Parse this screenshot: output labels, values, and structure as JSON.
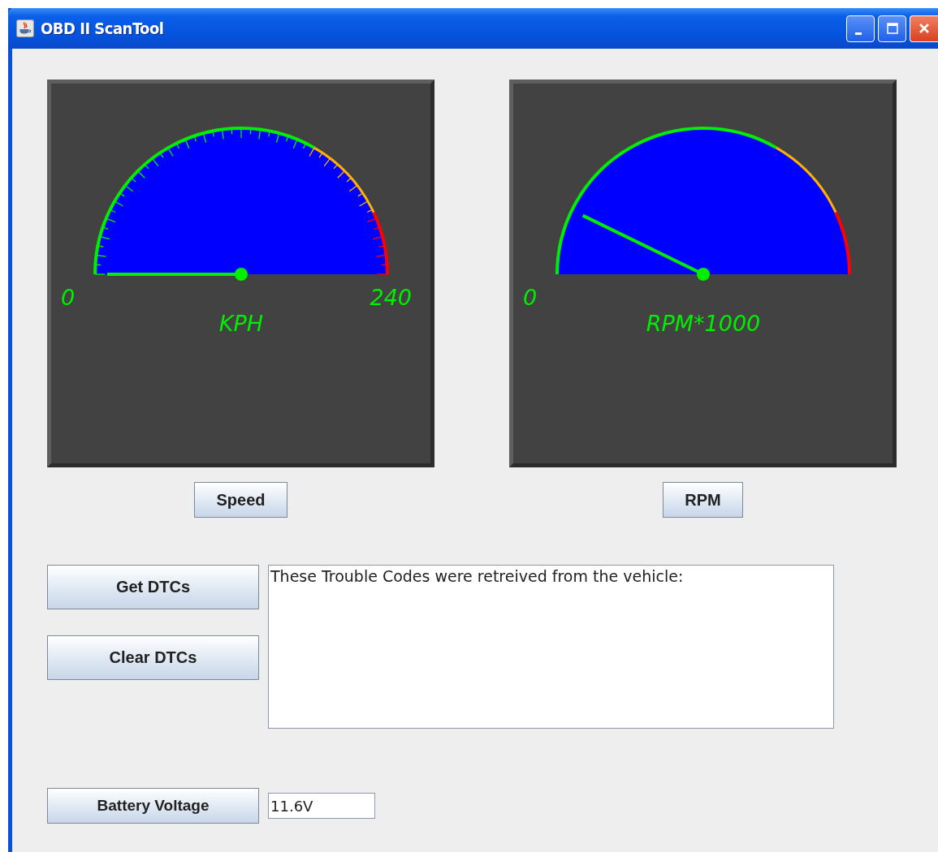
{
  "window": {
    "title": "OBD II ScanTool"
  },
  "gauges": [
    {
      "min_label": "0",
      "max_label": "240",
      "unit": "KPH",
      "ticks": true,
      "button": "Speed"
    },
    {
      "min_label": "0",
      "unit": "RPM*1000",
      "ticks": false,
      "button": "RPM"
    }
  ],
  "dtc_buttons": [
    "Get DTCs",
    "Clear DTCs"
  ],
  "dtc_output": {
    "value": "These Trouble Codes were retreived from the vehicle:"
  },
  "battery": {
    "button": "Battery Voltage",
    "value": "11.6V"
  }
}
